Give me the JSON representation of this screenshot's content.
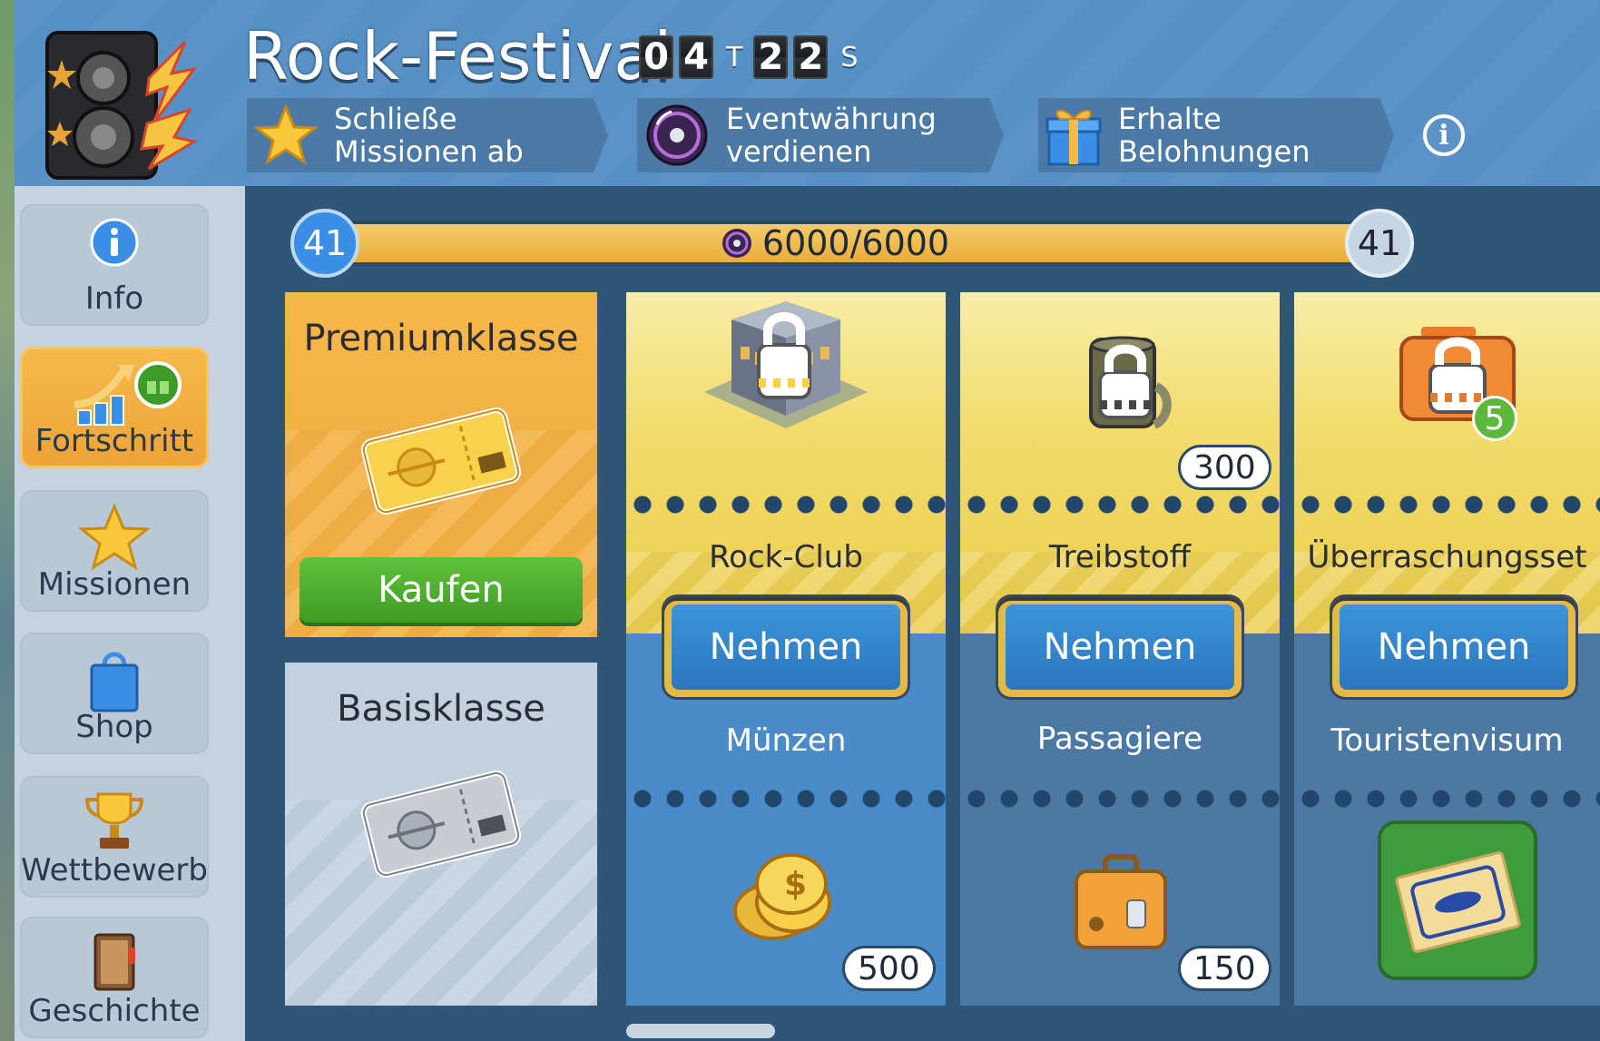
{
  "event": {
    "title": "Rock-Festival",
    "timer": {
      "days": [
        "0",
        "4"
      ],
      "days_unit": "T",
      "seconds": [
        "2",
        "2"
      ],
      "seconds_unit": "S"
    },
    "steps": [
      {
        "label": "Schließe Missionen ab",
        "icon": "star-icon"
      },
      {
        "label": "Eventwährung verdienen",
        "icon": "disc-icon"
      },
      {
        "label": "Erhalte Belohnungen",
        "icon": "gift-icon"
      }
    ],
    "info_icon": "i"
  },
  "sidebar": {
    "items": [
      {
        "label": "Info",
        "icon": "info-icon",
        "active": false
      },
      {
        "label": "Fortschritt",
        "icon": "progress-chart-icon",
        "active": true
      },
      {
        "label": "Missionen",
        "icon": "star-icon",
        "active": false
      },
      {
        "label": "Shop",
        "icon": "shopping-bag-icon",
        "active": false
      },
      {
        "label": "Wettbewerb",
        "icon": "trophy-icon",
        "active": false
      },
      {
        "label": "Geschichte",
        "icon": "book-icon",
        "active": false
      }
    ]
  },
  "progress": {
    "level_current": "41",
    "level_next": "41",
    "text": "6000/6000",
    "fraction": 1.0,
    "currency_icon": "disc-icon"
  },
  "tiers": {
    "premium": {
      "name": "Premiumklasse",
      "buy_label": "Kaufen",
      "icon": "gold-ticket-icon"
    },
    "basic": {
      "name": "Basisklasse",
      "icon": "silver-ticket-icon"
    }
  },
  "rewards": [
    {
      "premium": {
        "name": "Rock-Club",
        "icon": "rock-club-building-icon",
        "locked": true,
        "qty": ""
      },
      "button": "Nehmen",
      "basic": {
        "name": "Münzen",
        "icon": "coins-icon",
        "qty": "500"
      }
    },
    {
      "premium": {
        "name": "Treibstoff",
        "icon": "fuel-barrel-icon",
        "locked": true,
        "qty": "300"
      },
      "button": "Nehmen",
      "basic": {
        "name": "Passagiere",
        "icon": "suitcase-icon",
        "qty": "150"
      }
    },
    {
      "premium": {
        "name": "Überraschungsset",
        "icon": "surprise-box-icon",
        "locked": true,
        "qty": "",
        "badge": "5"
      },
      "button": "Nehmen",
      "basic": {
        "name": "Touristenvisum",
        "icon": "tourist-visa-icon",
        "qty": ""
      }
    }
  ],
  "colors": {
    "header": "#5c93c7",
    "premium": "#f3b145",
    "take_button": "#2c76bd",
    "buy_button": "#3e9b25"
  }
}
